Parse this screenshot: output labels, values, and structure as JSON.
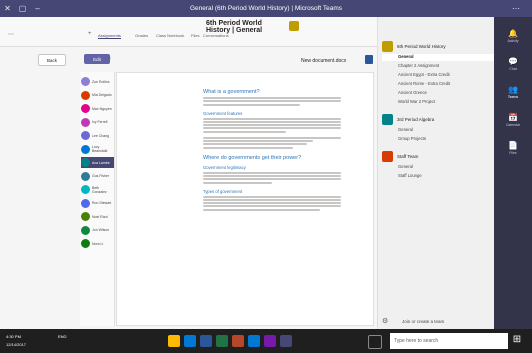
{
  "window": {
    "title": "General (6th Period World History) | Microsoft Teams"
  },
  "channel_header": {
    "team": "6th Period World History",
    "channel": "General",
    "tabs": [
      "Conversations",
      "Files",
      "Class Notebook",
      "Assignments",
      "Grades"
    ],
    "active_tab": "Assignments",
    "add_tab_icon": "plus-icon",
    "more_icon": "ellipsis-icon"
  },
  "assignment_toolbar": {
    "back_label": "Back",
    "primary_label": "Edit",
    "doc_title": "New document.docx"
  },
  "students": [
    {
      "name": "Zoe Rollins",
      "color": "#8b80d6"
    },
    {
      "name": "Mia Delgado",
      "color": "#d83b01"
    },
    {
      "name": "Max Nguyen",
      "color": "#e3008c"
    },
    {
      "name": "Ivy Ferrell",
      "color": "#c239b3"
    },
    {
      "name": "Lee Chang",
      "color": "#6b69d6"
    },
    {
      "name": "Lucy Beanstalk",
      "color": "#0078d4"
    },
    {
      "name": "Ava Lambe",
      "color": "#038387",
      "selected": true
    },
    {
      "name": "Gus Fisher",
      "color": "#2d7d9a"
    },
    {
      "name": "Beth Gonzalez",
      "color": "#00b7c3"
    },
    {
      "name": "Ron Stewart",
      "color": "#4f6bed"
    },
    {
      "name": "Noel Rizzi",
      "color": "#498205"
    },
    {
      "name": "Jon Wilson",
      "color": "#10893e"
    },
    {
      "name": "Nora Li",
      "color": "#107c10"
    }
  ],
  "document": {
    "heading1": "What is a government?",
    "subheading1": "Government features",
    "heading2": "Where do governments get their power?",
    "subheading2": "Government legitimacy",
    "subheading3": "Types of government"
  },
  "teams": [
    {
      "name": "6th Period World History",
      "color": "#c19c00",
      "channels": [
        "General",
        "Chapter 2 Assignment",
        "Ancient Egypt - Extra Credit",
        "Ancient Rome - Extra Credit",
        "Ancient Greece",
        "World War 2 Project"
      ],
      "active_channel": "General"
    },
    {
      "name": "3rd Period Algebra",
      "color": "#038387",
      "channels": [
        "General",
        "Group Projects"
      ]
    },
    {
      "name": "Staff Team",
      "color": "#d83b01",
      "channels": [
        "General",
        "Staff Lounge"
      ]
    }
  ],
  "team_list_footer": {
    "join_label": "Join or create a team",
    "settings_icon": "gear-icon"
  },
  "left_rail": [
    {
      "icon": "bell-icon",
      "label": "Activity"
    },
    {
      "icon": "chat-icon",
      "label": "Chat"
    },
    {
      "icon": "teams-icon",
      "label": "Teams",
      "active": true
    },
    {
      "icon": "calendar-icon",
      "label": "Calendar"
    },
    {
      "icon": "files-icon",
      "label": "Files"
    }
  ],
  "taskbar": {
    "search_placeholder": "Type here to search",
    "time": "4:30 PM",
    "date": "12/14/2017",
    "lang": "ENG"
  },
  "colors": {
    "brand": "#464775",
    "rail": "#33344a",
    "heading": "#2e74b5"
  }
}
